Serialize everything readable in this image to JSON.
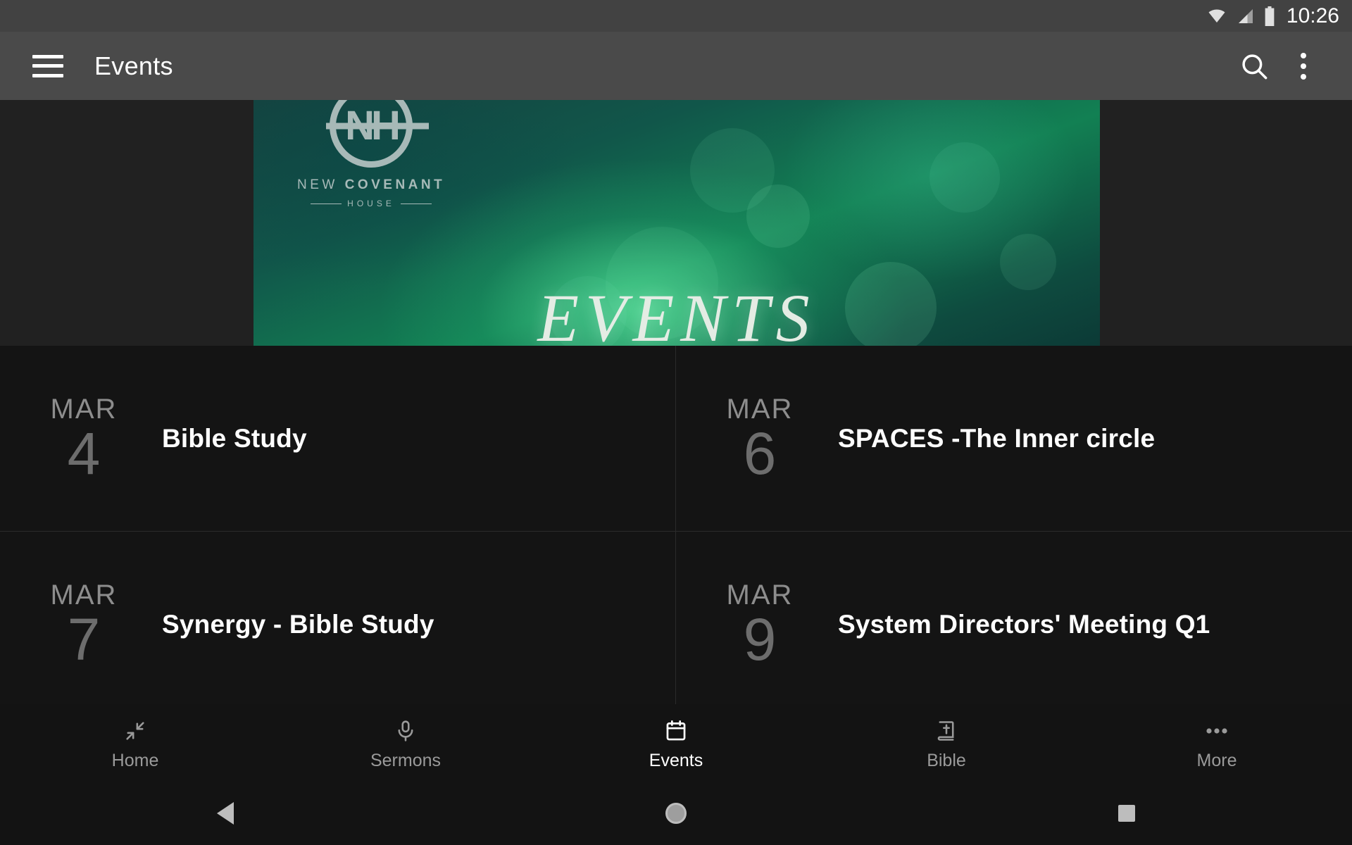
{
  "statusbar": {
    "time": "10:26",
    "icons": [
      "wifi-icon",
      "cellular-signal-icon",
      "battery-icon"
    ]
  },
  "appbar": {
    "menu_icon": "hamburger-menu-icon",
    "title": "Events",
    "search_icon": "search-icon",
    "overflow_icon": "overflow-menu-icon"
  },
  "hero": {
    "logo": {
      "monogram": "NH",
      "name_first": "NEW ",
      "name_second": "COVENANT",
      "subtitle": "HOUSE"
    },
    "title": "EVENTS"
  },
  "events": [
    {
      "month": "MAR",
      "day": "4",
      "title": "Bible Study"
    },
    {
      "month": "MAR",
      "day": "6",
      "title": "SPACES -The Inner circle"
    },
    {
      "month": "MAR",
      "day": "7",
      "title": "Synergy - Bible Study"
    },
    {
      "month": "MAR",
      "day": "9",
      "title": "System Directors' Meeting Q1"
    }
  ],
  "bottomnav": {
    "items": [
      {
        "label": "Home",
        "icon": "compress-arrows-icon",
        "active": false
      },
      {
        "label": "Sermons",
        "icon": "microphone-icon",
        "active": false
      },
      {
        "label": "Events",
        "icon": "calendar-icon",
        "active": true
      },
      {
        "label": "Bible",
        "icon": "bible-book-icon",
        "active": false
      },
      {
        "label": "More",
        "icon": "ellipsis-icon",
        "active": false
      }
    ]
  },
  "sysnav": {
    "back": "back-triangle-icon",
    "home": "home-circle-icon",
    "recents": "recents-square-icon"
  },
  "colors": {
    "statusbar_bg": "#424242",
    "appbar_bg": "#4a4a4a",
    "page_bg": "#212121",
    "grid_bg": "#141414",
    "nav_bg": "#131313",
    "accent_green": "#12a06a",
    "active_text": "#ffffff",
    "inactive_text": "#9a9a9a",
    "date_text": "#8d8d8d"
  }
}
